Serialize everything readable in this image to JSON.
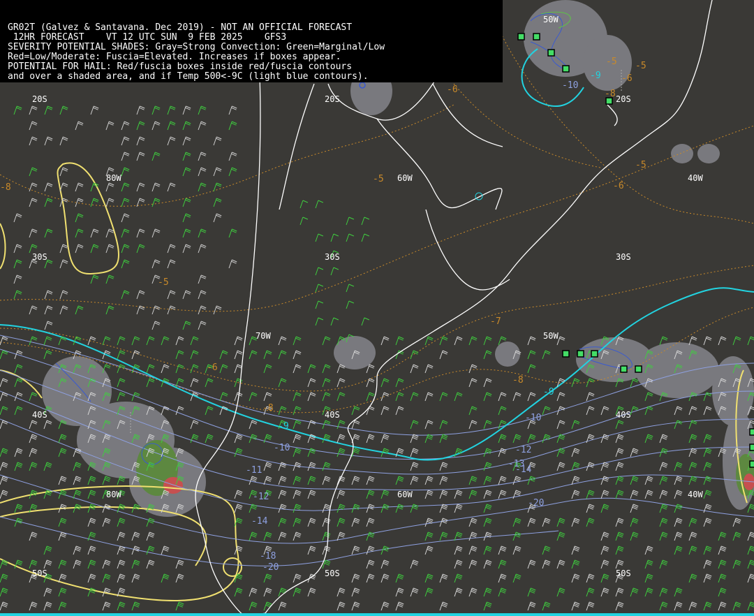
{
  "header": {
    "line1": "GR02T (Galvez & Santavana. Dec 2019) - NOT AN OFFICIAL FORECAST",
    "line2": " 12HR FORECAST    VT 12 UTC SUN  9 FEB 2025    GFS3",
    "line3": "SEVERITY POTENTIAL SHADES: Gray=Strong Convection: Green=Marginal/Low",
    "line4": "Red=Low/Moderate: Fuscia=Elevated. Increases if boxes appear.",
    "line5": "POTENTIAL FOR HAIL: Red/fuscia boxes inside red/fuscia contours",
    "line6": "and over a shaded area, and if Temp 500<-9C (light blue contours)."
  },
  "grid_labels": {
    "lat_20s_a": "20S",
    "lat_20s_b": "20S",
    "lat_20s_c": "20S",
    "lat_30s_a": "30S",
    "lat_30s_b": "30S",
    "lat_30s_c": "30S",
    "lat_40s_a": "40S",
    "lat_40s_b": "40S",
    "lat_40s_c": "40S",
    "lat_50s_a": "50S",
    "lat_50s_b": "50S",
    "lat_50s_c": "50S",
    "lon_80w_a": "80W",
    "lon_80w_b": "80W",
    "lon_70w": "70W",
    "lon_60w_a": "60W",
    "lon_60w_b": "60W",
    "lon_50w_a": "50W",
    "lon_50w_b": "50W",
    "lon_40w_a": "40W",
    "lon_40w_b": "40W"
  },
  "temperature_labels": {
    "t_m9_a": "-9",
    "t_m9_b": "-9",
    "t_m9_c": "-9",
    "t_m10_a": "-10",
    "t_m10_b": "-10",
    "t_m10_c": "-10",
    "t_m11": "-11",
    "t_m12_a": "-12",
    "t_m12_b": "-12",
    "t_m13": "-13",
    "t_m14_a": "-14",
    "t_m14_b": "-14",
    "t_m18": "-18",
    "t_m20_a": "-20",
    "t_m20_b": "-20",
    "t_m5_a": "-5",
    "t_m5_b": "-5",
    "t_m5_c": "-5",
    "t_m5_d": "-5",
    "t_m5_e": "-5",
    "t_m6_a": "-6",
    "t_m6_b": "-6",
    "t_m6_c": "-6",
    "t_m6_d": "-6",
    "t_m7": "-7",
    "t_m8_a": "-8",
    "t_m8_b": "-8",
    "t_m8_c": "-8",
    "t_m8_d": "-8"
  },
  "colors": {
    "background": "#3a3936",
    "coast": "#ffffff",
    "cold_contour": "#22d3e0",
    "temp_contour": "#8ea0e0",
    "warm_contour": "#c98a2a",
    "strong_convection": "#8a8a90",
    "marginal": "#5a9a3a",
    "moderate": "#d05050",
    "severe_zone": "#f0e070",
    "box": "#44dd66"
  }
}
